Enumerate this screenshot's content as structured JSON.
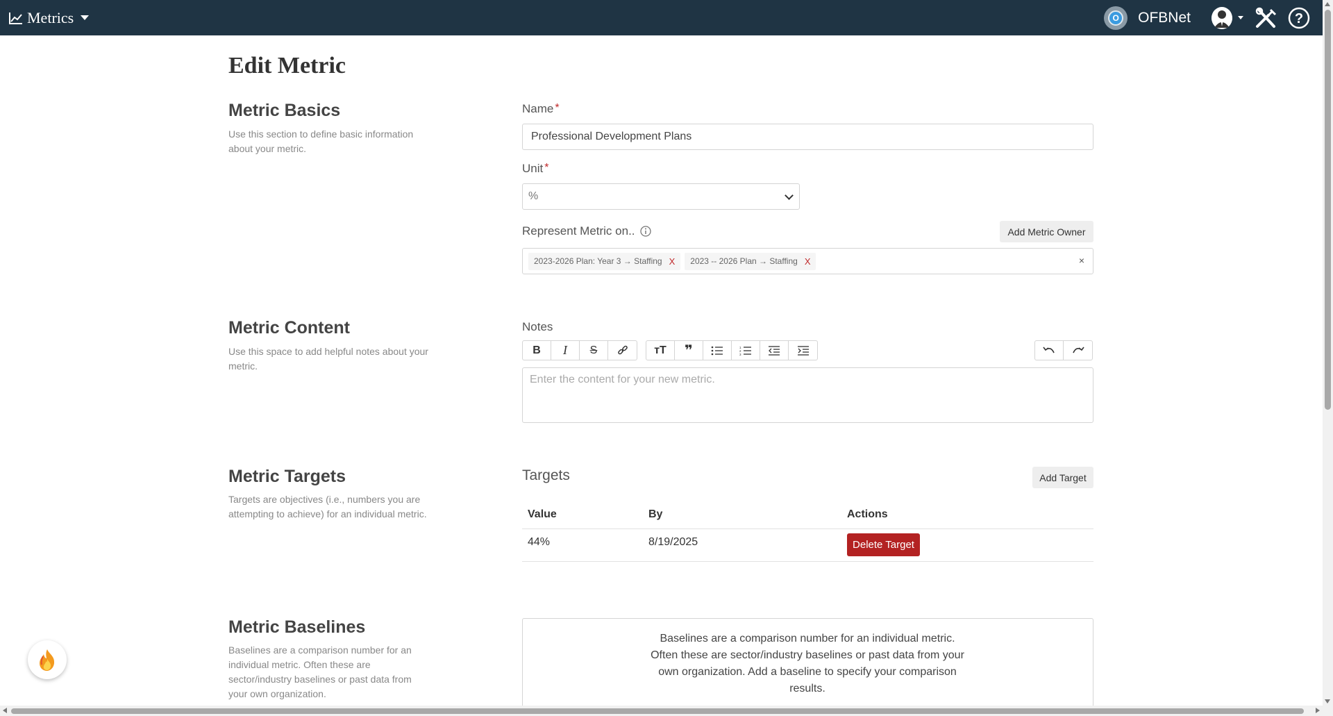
{
  "nav": {
    "brand": "Metrics",
    "org_name": "OFBNet",
    "org_logo_letter": "O",
    "icons": [
      "chart-line-icon",
      "chevron-down-icon",
      "avatar-icon",
      "tools-icon",
      "help-icon"
    ]
  },
  "page": {
    "title": "Edit Metric"
  },
  "sections": {
    "basics": {
      "title": "Metric Basics",
      "desc": "Use this section to define basic information about your metric."
    },
    "content": {
      "title": "Metric Content",
      "desc": "Use this space to add helpful notes about your metric."
    },
    "targets": {
      "title": "Metric Targets",
      "desc": "Targets are objectives (i.e., numbers you are attempting to achieve) for an individual metric."
    },
    "baselines": {
      "title": "Metric Baselines",
      "desc": "Baselines are a comparison number for an individual metric. Often these are sector/industry baselines or past data from your own organization."
    }
  },
  "form": {
    "name_label": "Name",
    "required_mark": "*",
    "name_value": "Professional Development Plans",
    "unit_label": "Unit",
    "unit_value": "%",
    "represent_label": "Represent Metric on..",
    "add_owner_label": "Add Metric Owner",
    "tags": [
      {
        "label": "2023-2026 Plan: Year 3 → Staffing",
        "remove": "X"
      },
      {
        "label": "2023 -- 2026 Plan → Staffing",
        "remove": "X"
      }
    ],
    "clear_tags": "×",
    "notes_label": "Notes",
    "notes_placeholder": "Enter the content for your new metric."
  },
  "targets": {
    "heading": "Targets",
    "add_label": "Add Target",
    "columns": [
      "Value",
      "By",
      "Actions"
    ],
    "rows": [
      {
        "value": "44%",
        "by": "8/19/2025",
        "action": "Delete Target"
      }
    ]
  },
  "baselines": {
    "info": "Baselines are a comparison number for an individual metric. Often these are sector/industry baselines or past data from your own organization. Add a baseline to specify your comparison results."
  },
  "colors": {
    "navbar": "#1f3444",
    "danger": "#b32222",
    "required": "#c0292b"
  }
}
